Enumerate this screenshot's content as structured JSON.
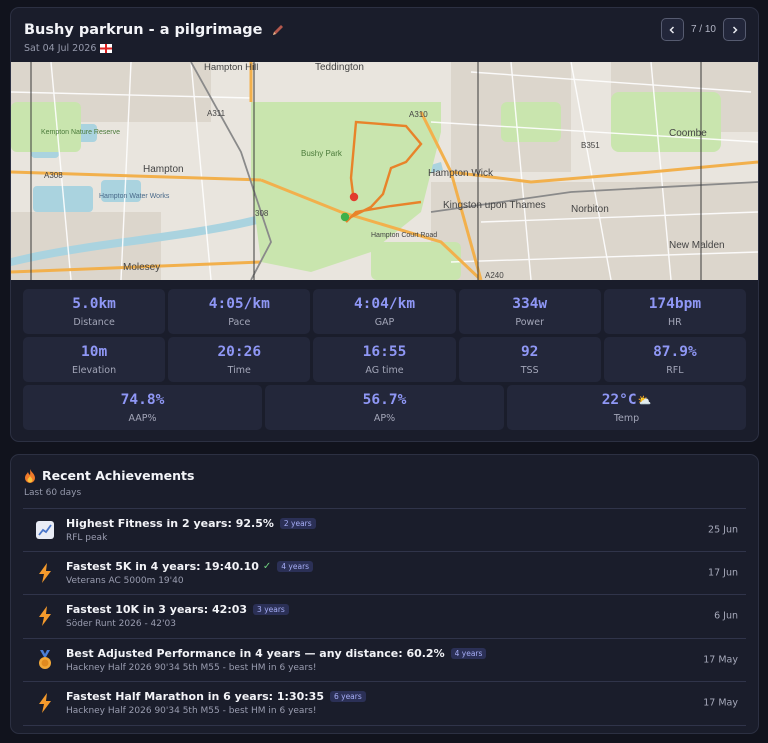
{
  "activity": {
    "title": "Bushy parkrun - a pilgrimage",
    "date": "Sat 04 Jul 2026",
    "pager": {
      "text": "7 / 10"
    },
    "map": {
      "labels": [
        "Hampton Hill",
        "Teddington",
        "A311",
        "A310",
        "A308",
        "Kempton Nature Reserve",
        "Hampton",
        "Bushy Park",
        "Hampton Wick",
        "B351",
        "Kingston upon Thames",
        "Norbiton",
        "Coombe",
        "New Malden",
        "Hampton Water Works",
        "Molesey",
        "A240",
        "Hampton Court Road",
        "308"
      ],
      "colors": {
        "park": "#cde8b6",
        "road_major": "#f1b04a",
        "route": "#e8832a",
        "start": "#e23b2e",
        "finish": "#3fb04a"
      }
    },
    "stats_row1": [
      {
        "value": "5.0km",
        "label": "Distance"
      },
      {
        "value": "4:05/km",
        "label": "Pace"
      },
      {
        "value": "4:04/km",
        "label": "GAP"
      },
      {
        "value": "334w",
        "label": "Power"
      },
      {
        "value": "174bpm",
        "label": "HR"
      }
    ],
    "stats_row2": [
      {
        "value": "10m",
        "label": "Elevation"
      },
      {
        "value": "20:26",
        "label": "Time"
      },
      {
        "value": "16:55",
        "label": "AG time"
      },
      {
        "value": "92",
        "label": "TSS"
      },
      {
        "value": "87.9%",
        "label": "RFL"
      }
    ],
    "stats_row3": [
      {
        "value": "74.8%",
        "label": "AAP%"
      },
      {
        "value": "56.7%",
        "label": "AP%"
      },
      {
        "value": "22°C",
        "label": "Temp",
        "weather_icon": "sun-behind-cloud"
      }
    ],
    "accent_color": "#8f97f5"
  },
  "achievements": {
    "title": "Recent Achievements",
    "subtitle": "Last 60 days",
    "items": [
      {
        "icon": "chart-increasing-icon",
        "name": "Highest Fitness in 2 years: 92.5%",
        "check": "",
        "badge": "2 years",
        "desc": "RFL peak",
        "date": "25 Jun"
      },
      {
        "icon": "lightning-icon",
        "name": "Fastest 5K in 4 years: 19:40.10",
        "check": "✓",
        "badge": "4 years",
        "desc": "Veterans AC 5000m 19'40",
        "date": "17 Jun"
      },
      {
        "icon": "lightning-icon",
        "name": "Fastest 10K in 3 years: 42:03",
        "check": "",
        "badge": "3 years",
        "desc": "Söder Runt 2026 - 42'03",
        "date": "6 Jun"
      },
      {
        "icon": "medal-icon",
        "name": "Best Adjusted Performance in 4 years — any distance: 60.2%",
        "check": "",
        "badge": "4 years",
        "desc": "Hackney Half 2026 90'34 5th M55 - best HM in 6 years!",
        "date": "17 May"
      },
      {
        "icon": "lightning-icon",
        "name": "Fastest Half Marathon in 6 years: 1:30:35",
        "check": "",
        "badge": "6 years",
        "desc": "Hackney Half 2026 90'34 5th M55 - best HM in 6 years!",
        "date": "17 May"
      }
    ]
  }
}
